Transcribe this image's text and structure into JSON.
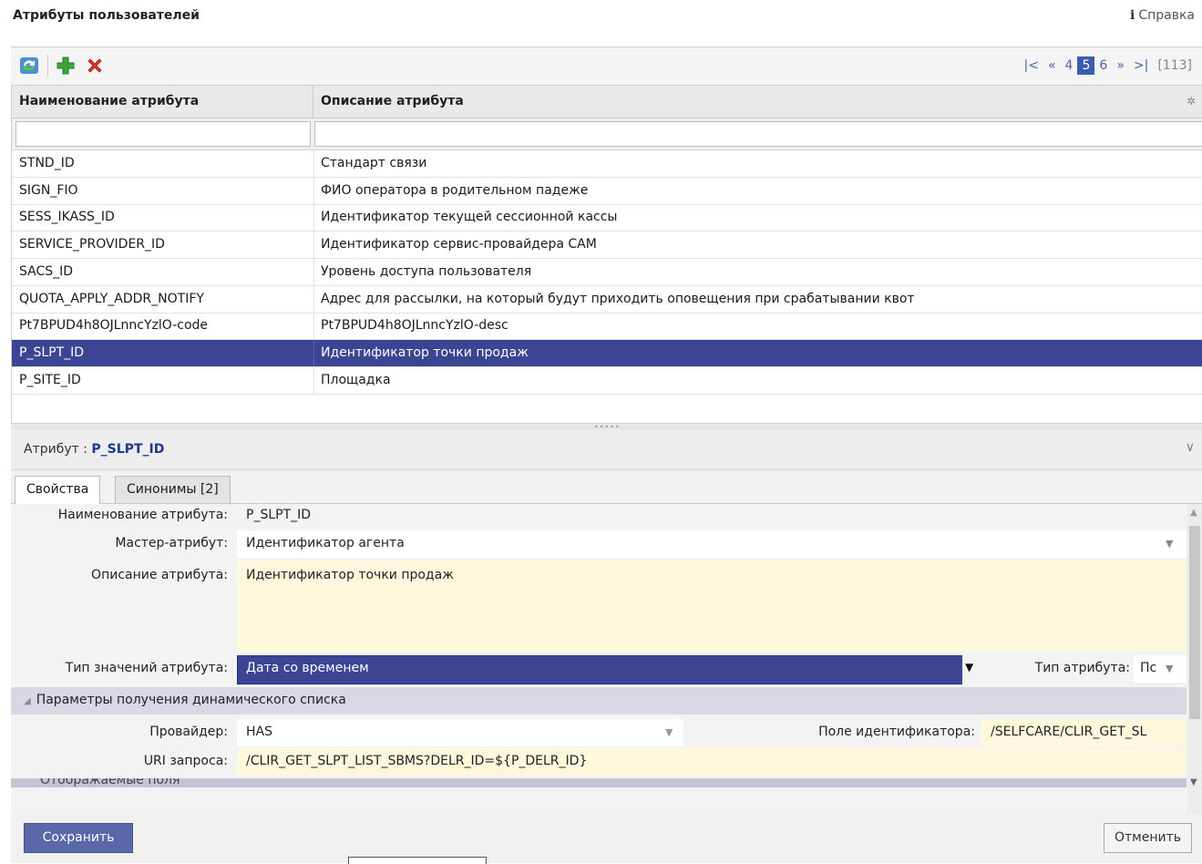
{
  "header": {
    "title": "Атрибуты пользователей",
    "help_label": "Справка",
    "help_icon": "info-icon"
  },
  "toolbar": {
    "icons": [
      "refresh-icon",
      "add-icon",
      "delete-icon"
    ],
    "pager": {
      "first": "|<",
      "prev": "«",
      "pages": [
        "4",
        "5",
        "6"
      ],
      "current": "5",
      "next": "»",
      "last": ">|",
      "total": "[113]"
    }
  },
  "grid": {
    "columns": [
      "Наименование атрибута",
      "Описание атрибута"
    ],
    "rows": [
      {
        "name": "STND_ID",
        "desc": "Стандарт связи"
      },
      {
        "name": "SIGN_FIO",
        "desc": "ФИО оператора в родительном падеже"
      },
      {
        "name": "SESS_IKASS_ID",
        "desc": "Идентификатор текущей сессионной кассы"
      },
      {
        "name": "SERVICE_PROVIDER_ID",
        "desc": "Идентификатор сервис-провайдера САМ"
      },
      {
        "name": "SACS_ID",
        "desc": "Уровень доступа пользователя"
      },
      {
        "name": "QUOTA_APPLY_ADDR_NOTIFY",
        "desc": "Адрес для рассылки, на который будут приходить оповещения при срабатывании квот"
      },
      {
        "name": "Pt7BPUD4h8OJLnncYzlO-code",
        "desc": "Pt7BPUD4h8OJLnncYzlO-desc"
      },
      {
        "name": "P_SLPT_ID",
        "desc": "Идентификатор точки продаж"
      },
      {
        "name": "P_SITE_ID",
        "desc": "Площадка"
      }
    ],
    "selected_row": "P_SLPT_ID"
  },
  "detail": {
    "title_prefix": "Атрибут :",
    "title_value": "P_SLPT_ID",
    "tabs": [
      "Свойства",
      "Синонимы [2]"
    ],
    "active_tab": "Свойства",
    "fields": {
      "name_label": "Наименование атрибута:",
      "name_value": "P_SLPT_ID",
      "master_label": "Мастер-атрибут:",
      "master_value": "Идентификатор агента",
      "desc_label": "Описание атрибута:",
      "desc_value": "Идентификатор точки продаж",
      "valtype_label": "Тип значений атрибута:",
      "valtype_value": "Дата со временем",
      "attrtype_label": "Тип атрибута:",
      "attrtype_value": "Пс"
    },
    "section_dynamic": {
      "title": "Параметры получения динамического списка",
      "provider_label": "Провайдер:",
      "provider_value": "HAS",
      "idfield_label": "Поле идентификатора:",
      "idfield_value": "/SELFCARE/CLIR_GET_SL",
      "uri_label": "URI запроса:",
      "uri_value": "/CLIR_GET_SLPT_LIST_SBMS?DELR_ID=${P_DELR_ID}"
    },
    "section_display": {
      "title": "Отображаемые поля"
    }
  },
  "buttons": {
    "save": "Сохранить",
    "cancel": "Отменить"
  },
  "colors": {
    "accent": "#3b5bb0",
    "selected_row": "#3c4594",
    "field_yellow": "#fdf8dc",
    "section_bg": "#d8d8e4"
  }
}
